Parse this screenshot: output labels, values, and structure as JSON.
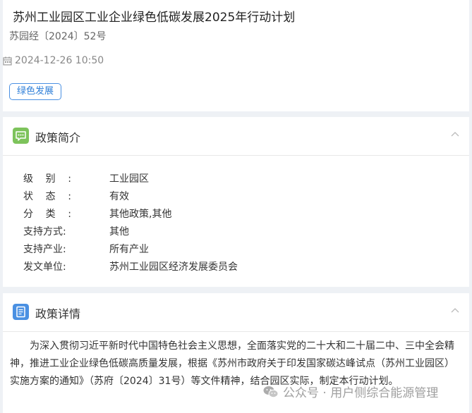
{
  "policy": {
    "title": "苏州工业园区工业企业绿色低碳发展2025年行动计划",
    "doc_number": "苏园经〔2024〕52号",
    "date": "2024-12-26 10:50",
    "tag": "绿色发展"
  },
  "intro": {
    "section_title": "政策简介",
    "rows": [
      {
        "label": "级别:",
        "value": "工业园区"
      },
      {
        "label": "状态:",
        "value": "有效"
      },
      {
        "label": "分类:",
        "value": "其他政策,其他"
      },
      {
        "label": "支持方式:",
        "value": "其他"
      },
      {
        "label": "支持产业:",
        "value": "所有产业"
      },
      {
        "label": "发文单位:",
        "value": "苏州工业园区经济发展委员会"
      }
    ]
  },
  "detail": {
    "section_title": "政策详情",
    "paragraph": "为深入贯彻习近平新时代中国特色社会主义思想，全面落实党的二十大和二十届二中、三中全会精神，推进工业企业绿色低碳高质量发展，根据《苏州市政府关于印发国家碳达峰试点（苏州工业园区）实施方案的通知》（苏府〔2024〕31号）等文件精神，结合园区实际，制定本行动计划。"
  },
  "watermark": {
    "text": "公众号 · 用户侧综合能源管理"
  },
  "colors": {
    "tag_blue": "#2f7fd8",
    "intro_icon": "#7dc35b",
    "detail_icon": "#4a90e2"
  }
}
